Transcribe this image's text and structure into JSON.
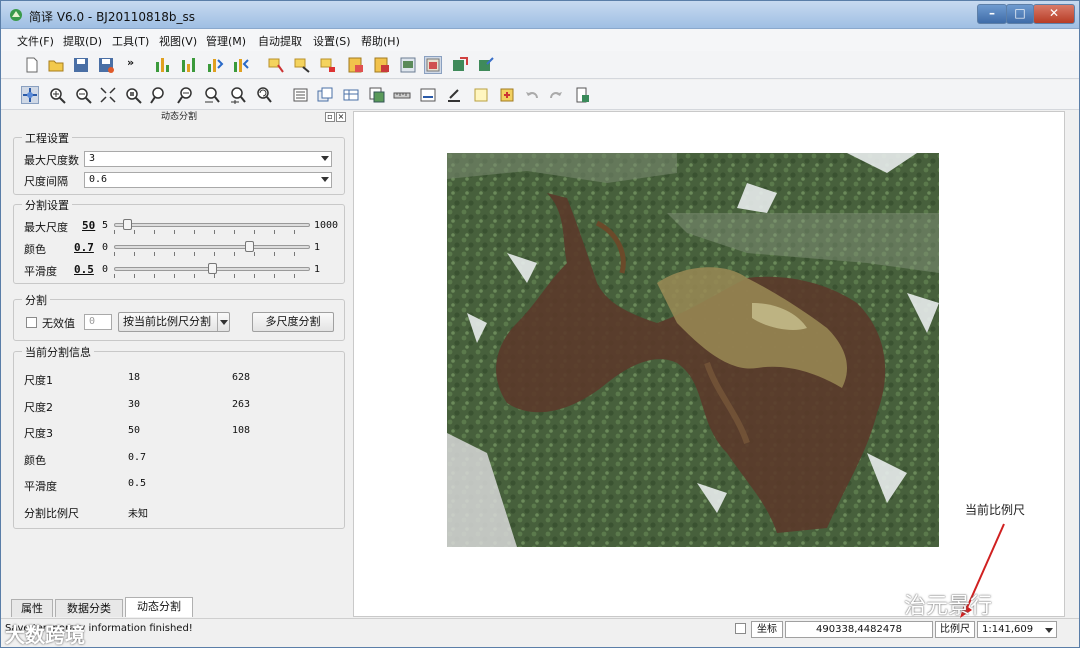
{
  "window": {
    "title": "简译 V6.0 - BJ20110818b_ss",
    "min_label": "–",
    "max_label": "□",
    "close_label": "✕"
  },
  "menu": [
    "文件(F)",
    "提取(D)",
    "工具(T)",
    "视图(V)",
    "管理(M)",
    "自动提取",
    "设置(S)",
    "帮助(H)"
  ],
  "toolbar1": {
    "more_label": "»",
    "icons": [
      "new-file-icon",
      "open-folder-icon",
      "save-icon",
      "save-as-icon",
      "bar-chart-green-icon",
      "bar-chart-icon",
      "chart-split-icon",
      "chart-merge-icon",
      "select-region-icon",
      "edit-region-icon",
      "delete-region-icon",
      "layer-add-icon",
      "layer-remove-icon",
      "layer-props-icon",
      "layer-active-icon",
      "export-icon",
      "import-icon"
    ]
  },
  "toolbar2": {
    "icons": [
      "pan-icon",
      "zoom-in-icon",
      "zoom-out-icon",
      "zoom-full-icon",
      "zoom-layer-icon",
      "zoom-select-in-icon",
      "zoom-select-out-icon",
      "zoom-prev-icon",
      "zoom-next-icon",
      "zoom-refresh-icon",
      "layer-list-icon",
      "layer-copy-icon",
      "layer-table-icon",
      "layer-swipe-icon",
      "measure-icon",
      "ruler-icon",
      "identify-icon",
      "note-icon",
      "bookmark-icon",
      "undo-icon",
      "redo-icon",
      "print-icon"
    ]
  },
  "panel": {
    "title": "动态分割",
    "project_group": {
      "title": "工程设置",
      "max_scale_label": "最大尺度数",
      "max_scale_value": "3",
      "interval_label": "尺度间隔",
      "interval_value": "0.6"
    },
    "seg_group": {
      "title": "分割设置",
      "sliders": [
        {
          "label": "最大尺度",
          "value": "50",
          "min": "5",
          "max": "1000",
          "level": 0.05
        },
        {
          "label": "颜色",
          "value": "0.7",
          "min": "0",
          "max": "1",
          "level": 0.7
        },
        {
          "label": "平滑度",
          "value": "0.5",
          "min": "0",
          "max": "1",
          "level": 0.5
        }
      ]
    },
    "split_group": {
      "title": "分割",
      "nodata_label": "无效值",
      "nodata_value": "0",
      "mode_value": "按当前比例尺分割",
      "multi_button": "多尺度分割"
    },
    "info_group": {
      "title": "当前分割信息",
      "rows": [
        [
          "尺度1",
          "18",
          "628"
        ],
        [
          "尺度2",
          "30",
          "263"
        ],
        [
          "尺度3",
          "50",
          "108"
        ],
        [
          "颜色",
          "0.7",
          ""
        ],
        [
          "平滑度",
          "0.5",
          ""
        ],
        [
          "分割比例尺",
          "未知",
          ""
        ]
      ]
    }
  },
  "tabs": [
    "属性",
    "数据分类",
    "动态分割"
  ],
  "status": {
    "message": "Save temporary information finished!",
    "coord_label": "坐标",
    "coord_value": "490338,4482478",
    "scale_label": "比例尺",
    "scale_value": "1:141,609"
  },
  "annotation": "当前比例尺",
  "watermarks": [
    "治元景行",
    "大数跨境"
  ]
}
